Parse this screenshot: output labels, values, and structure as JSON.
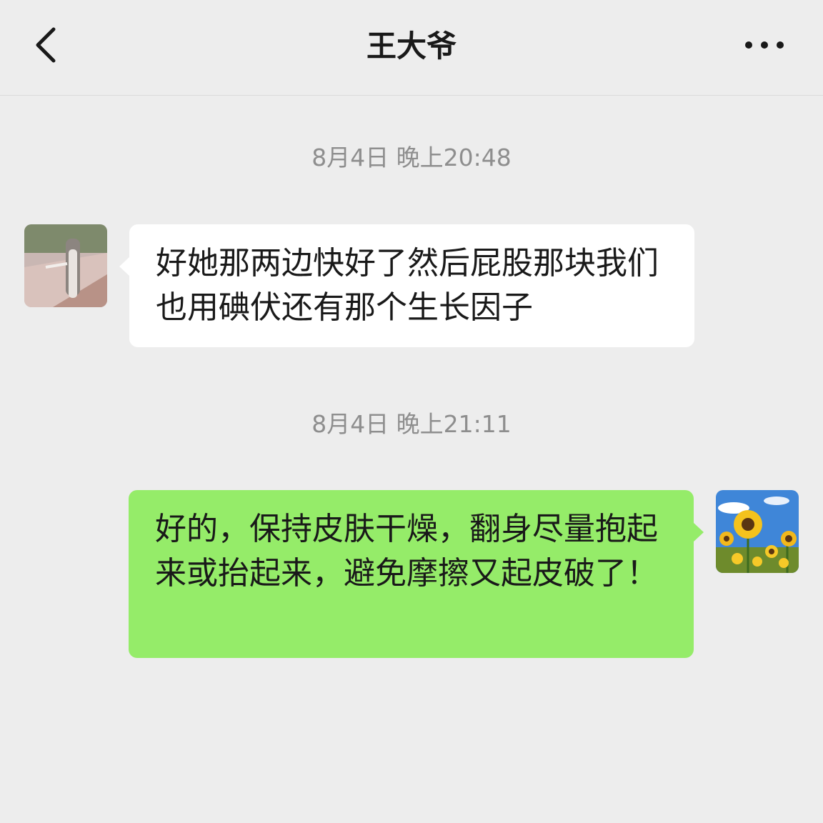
{
  "header": {
    "title": "王大爷",
    "back_icon": "chevron-left-icon",
    "more_icon": "more-dots-icon"
  },
  "messages": [
    {
      "timestamp": "8月4日 晚上20:48",
      "sender": "contact",
      "text": "好她那两边快好了然后屁股那块我们也用碘伏还有那个生长因子",
      "bubble_color": "#FFFFFF"
    },
    {
      "timestamp": "8月4日 晚上21:11",
      "sender": "self",
      "text": "好的，保持皮肤干燥，翻身尽量抱起来或抬起来，避免摩擦又起皮破了！",
      "bubble_color": "#95EC69"
    }
  ],
  "colors": {
    "background": "#EDEDED",
    "self_bubble": "#95EC69",
    "contact_bubble": "#FFFFFF",
    "timestamp_text": "#8E8E8E"
  }
}
